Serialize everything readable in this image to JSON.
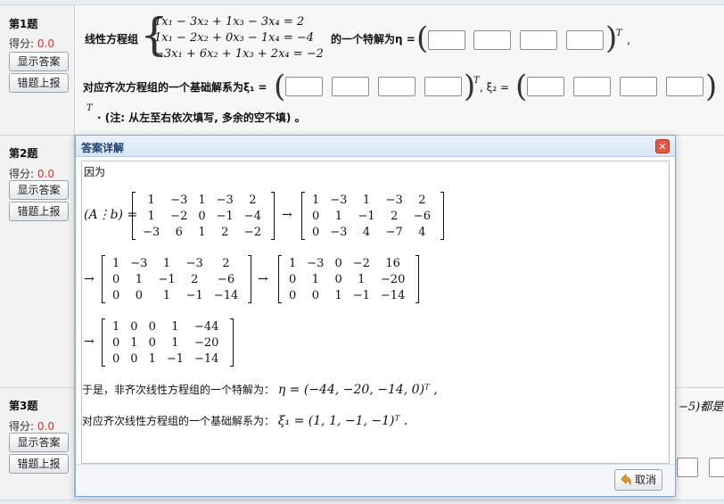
{
  "questions": [
    {
      "title": "第1题",
      "score_label": "得分:",
      "score": "0.0",
      "btn_show": "显示答案",
      "btn_report": "错题上报"
    },
    {
      "title": "第2题",
      "score_label": "得分:",
      "score": "0.0",
      "btn_show": "显示答案",
      "btn_report": "错题上报"
    },
    {
      "title": "第3题",
      "score_label": "得分:",
      "score": "0.0",
      "btn_show": "显示答案",
      "btn_report": "错题上报"
    }
  ],
  "q1": {
    "label_system": "线性方程组",
    "eq1": "1x₁ − 3x₂ + 1x₃ − 3x₄ = 2",
    "eq2": "1x₁ − 2x₂ + 0x₃ − 1x₄ = −4",
    "eq3": "−3x₁ + 6x₂ + 1x₃ + 2x₄ = −2",
    "label_particular": "的一个特解为η =",
    "sup_T": "T",
    "tail_comma": ",",
    "label_basis": "对应齐次方程组的一个基础解系为ξ₁ =",
    "label_xi2": ", ξ₂ =",
    "note": "· (注: 从左至右依次填写, 多余的空不填) 。"
  },
  "q3_fragment": "−5)都是该",
  "dialog": {
    "title": "答案详解",
    "close_glyph": "✕",
    "cancel_label": "取消",
    "intro": "因为",
    "ab_label": "(A⋮b) =",
    "arrow": "→",
    "m1": [
      [
        "1",
        "−3",
        "1",
        "−3",
        "2"
      ],
      [
        "1",
        "−2",
        "0",
        "−1",
        "−4"
      ],
      [
        "−3",
        "6",
        "1",
        "2",
        "−2"
      ]
    ],
    "m2": [
      [
        "1",
        "−3",
        "1",
        "−3",
        "2"
      ],
      [
        "0",
        "1",
        "−1",
        "2",
        "−6"
      ],
      [
        "0",
        "−3",
        "4",
        "−7",
        "4"
      ]
    ],
    "m3": [
      [
        "1",
        "−3",
        "1",
        "−3",
        "2"
      ],
      [
        "0",
        "1",
        "−1",
        "2",
        "−6"
      ],
      [
        "0",
        "0",
        "1",
        "−1",
        "−14"
      ]
    ],
    "m4": [
      [
        "1",
        "−3",
        "0",
        "−2",
        "16"
      ],
      [
        "0",
        "1",
        "0",
        "1",
        "−20"
      ],
      [
        "0",
        "0",
        "1",
        "−1",
        "−14"
      ]
    ],
    "m5": [
      [
        "1",
        "0",
        "0",
        "1",
        "−44"
      ],
      [
        "0",
        "1",
        "0",
        "1",
        "−20"
      ],
      [
        "0",
        "0",
        "1",
        "−1",
        "−14"
      ]
    ],
    "line_particular_prefix": "于是，非齐次线性方程组的一个特解为：",
    "line_particular_math": "η = (−44, −20, −14, 0)ᵀ ,",
    "line_basis_prefix": "对应齐次线性方程组的一个基础解系为：",
    "line_basis_math": "ξ₁ = (1, 1, −1, −1)ᵀ ."
  }
}
